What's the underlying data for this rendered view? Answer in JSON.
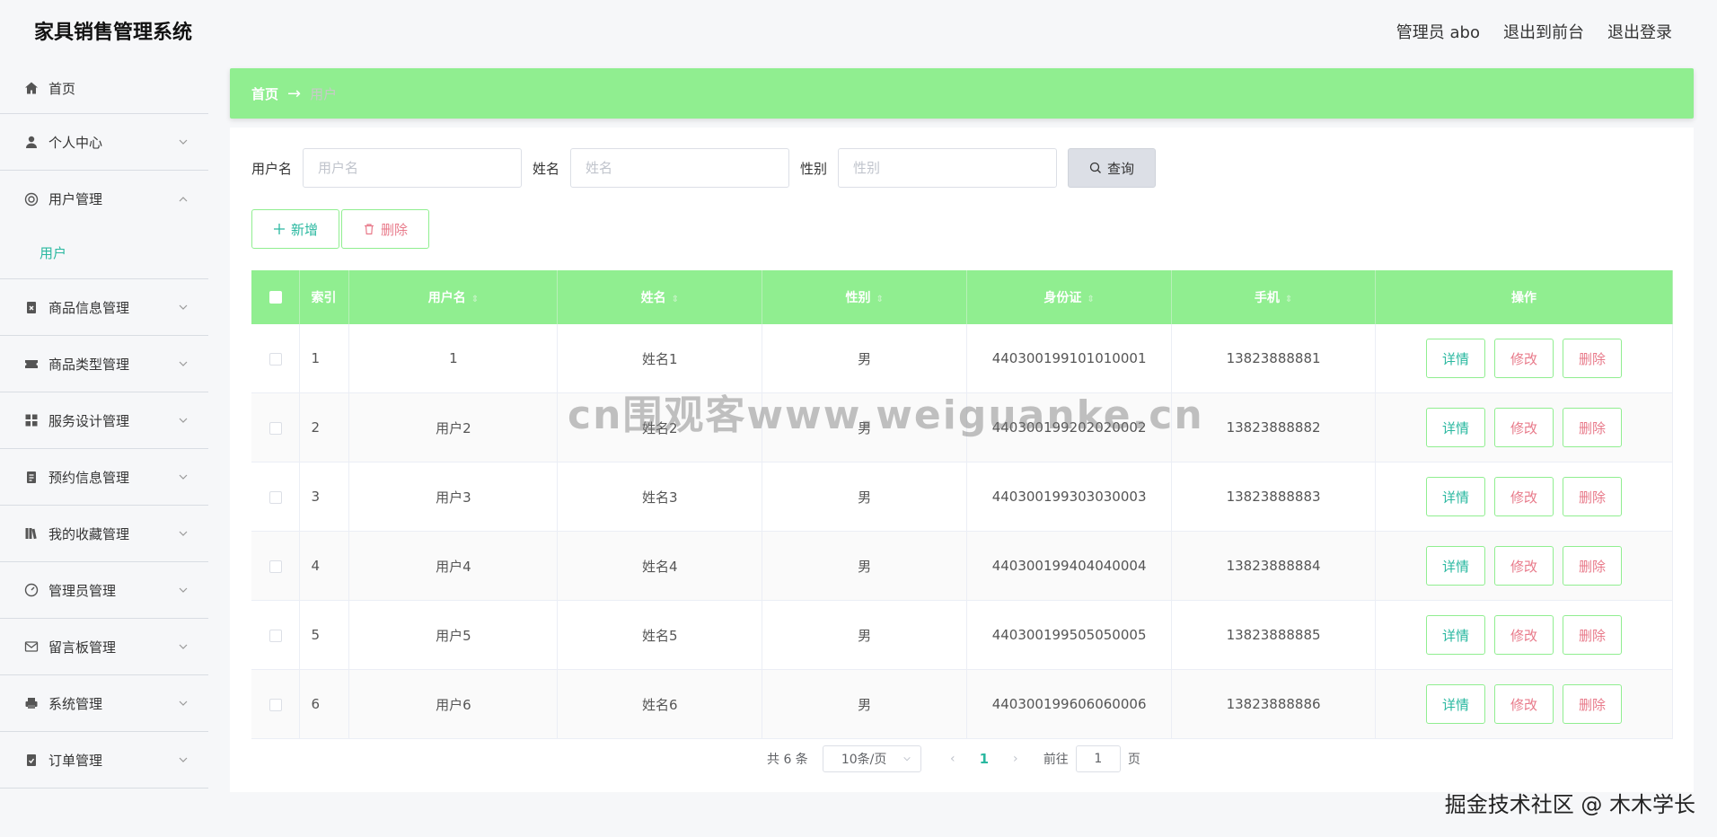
{
  "app": {
    "title": "家具销售管理系统",
    "top_links": [
      "管理员 abo",
      "退出到前台",
      "退出登录"
    ]
  },
  "sidebar": {
    "items": [
      {
        "label": "首页",
        "icon": "home-icon"
      },
      {
        "label": "个人中心",
        "icon": "user-icon"
      },
      {
        "label": "用户管理",
        "icon": "lifebuoy-icon",
        "expanded": true,
        "children": [
          "用户"
        ]
      },
      {
        "label": "商品信息管理",
        "icon": "clipboard-x-icon"
      },
      {
        "label": "商品类型管理",
        "icon": "ticket-icon"
      },
      {
        "label": "服务设计管理",
        "icon": "grid-icon"
      },
      {
        "label": "预约信息管理",
        "icon": "clipboard-icon"
      },
      {
        "label": "我的收藏管理",
        "icon": "books-icon"
      },
      {
        "label": "管理员管理",
        "icon": "gauge-icon"
      },
      {
        "label": "留言板管理",
        "icon": "mail-icon"
      },
      {
        "label": "系统管理",
        "icon": "printer-icon"
      },
      {
        "label": "订单管理",
        "icon": "clipboard-check-icon"
      }
    ]
  },
  "breadcrumb": {
    "home": "首页",
    "arrow": "→",
    "current": "用户"
  },
  "search": {
    "username_label": "用户名",
    "username_placeholder": "用户名",
    "name_label": "姓名",
    "name_placeholder": "姓名",
    "gender_label": "性别",
    "gender_placeholder": "性别",
    "query_label": "查询"
  },
  "actions": {
    "add_label": "新增",
    "delete_label": "删除"
  },
  "table": {
    "headers": [
      "索引",
      "用户名",
      "姓名",
      "性别",
      "身份证",
      "手机",
      "操作"
    ],
    "rows": [
      {
        "index": "1",
        "username": "1",
        "name": "姓名1",
        "gender": "男",
        "id_card": "440300199101010001",
        "phone": "13823888881"
      },
      {
        "index": "2",
        "username": "用户2",
        "name": "姓名2",
        "gender": "男",
        "id_card": "440300199202020002",
        "phone": "13823888882"
      },
      {
        "index": "3",
        "username": "用户3",
        "name": "姓名3",
        "gender": "男",
        "id_card": "440300199303030003",
        "phone": "13823888883"
      },
      {
        "index": "4",
        "username": "用户4",
        "name": "姓名4",
        "gender": "男",
        "id_card": "440300199404040004",
        "phone": "13823888884"
      },
      {
        "index": "5",
        "username": "用户5",
        "name": "姓名5",
        "gender": "男",
        "id_card": "440300199505050005",
        "phone": "13823888885"
      },
      {
        "index": "6",
        "username": "用户6",
        "name": "姓名6",
        "gender": "男",
        "id_card": "440300199606060006",
        "phone": "13823888886"
      }
    ],
    "op_labels": {
      "detail": "详情",
      "edit": "修改",
      "delete": "删除"
    }
  },
  "pagination": {
    "total": "共 6 条",
    "page_size": "10条/页",
    "current_page": "1",
    "goto_label": "前往",
    "goto_value": "1",
    "page_suffix": "页",
    "prev": "‹",
    "next": "›"
  },
  "watermarks": {
    "center": "cn围观客www.weiguanke.cn",
    "corner": "掘金技术社区 @ 木木学长"
  },
  "colors": {
    "accent": "#90ee90",
    "teal": "#2ab8a0",
    "danger": "#e87a8a"
  }
}
